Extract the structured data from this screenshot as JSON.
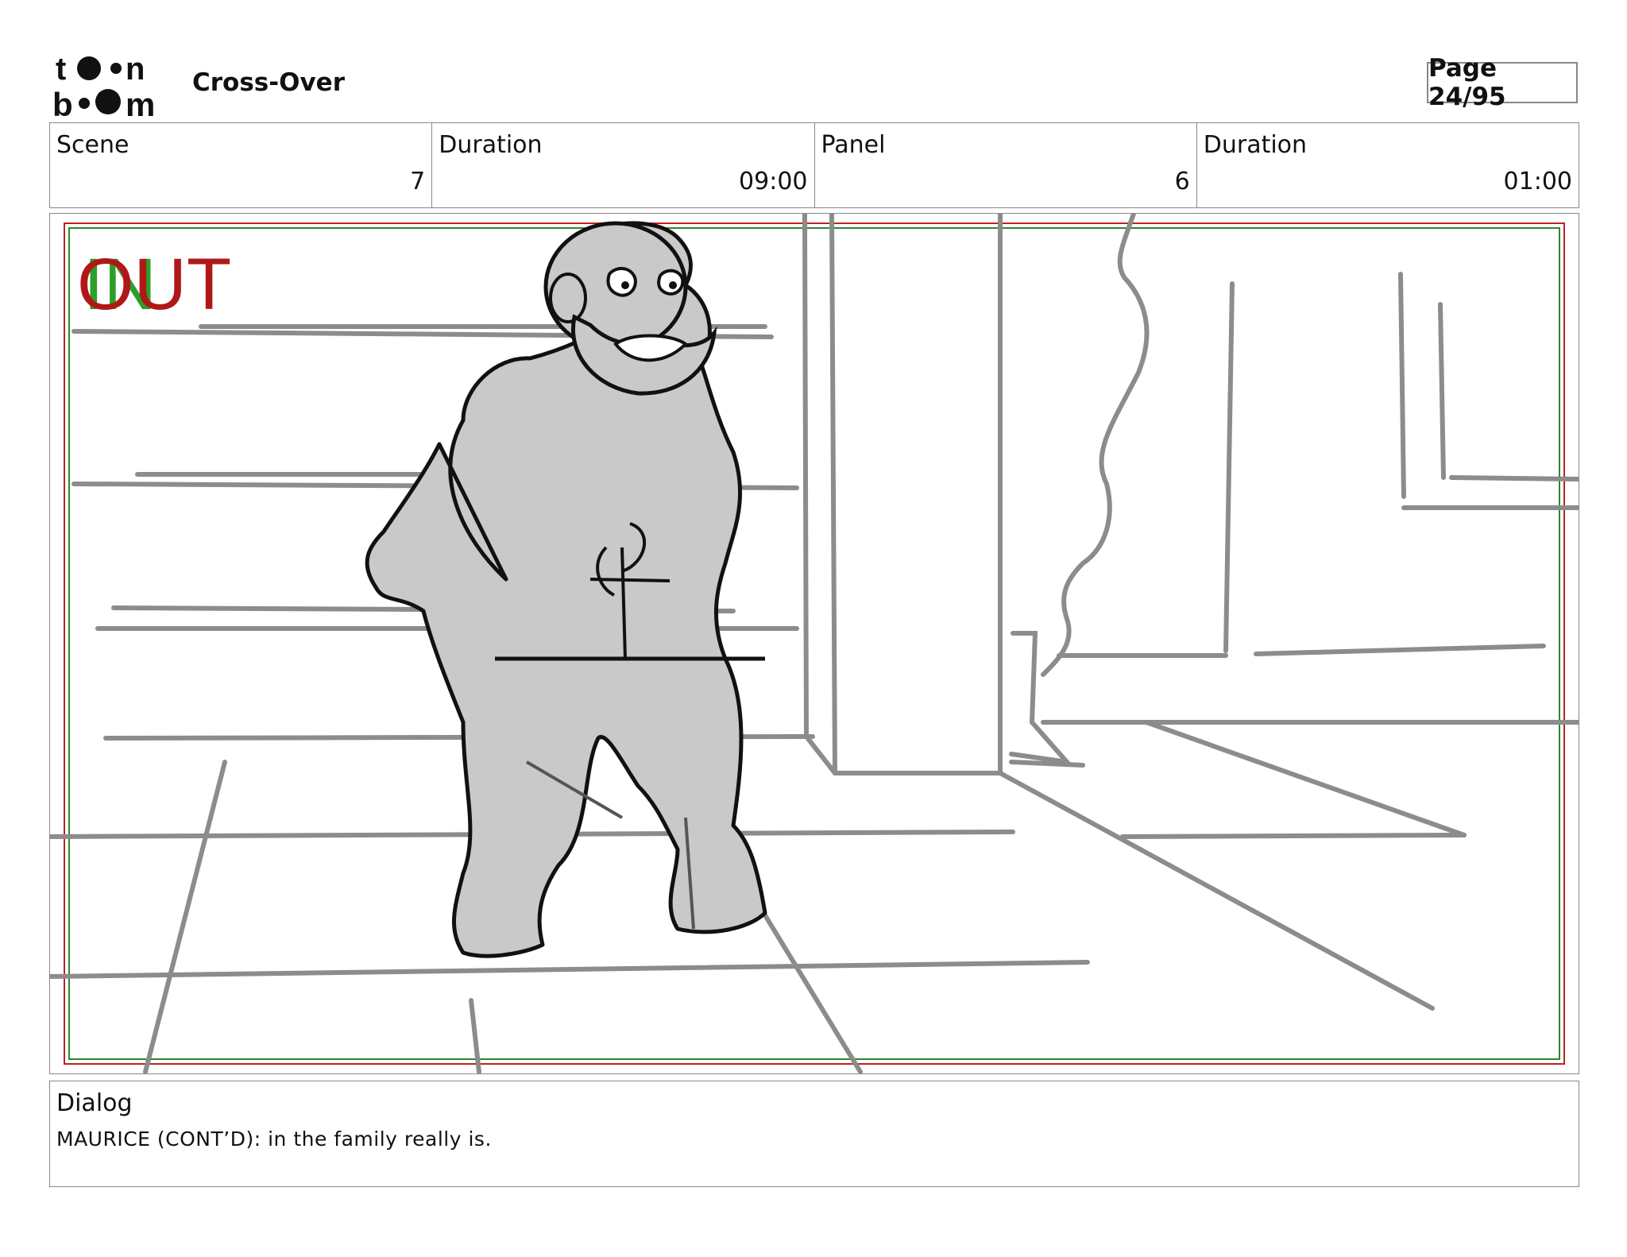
{
  "header": {
    "logo_text": "toonboom",
    "project_title": "Cross-Over",
    "page_label": "Page 24/95"
  },
  "info": {
    "scene_label": "Scene",
    "scene_value": "7",
    "scene_duration_label": "Duration",
    "scene_duration_value": "09:00",
    "panel_label": "Panel",
    "panel_value": "6",
    "panel_duration_label": "Duration",
    "panel_duration_value": "01:00"
  },
  "panel": {
    "in_marker": "IN",
    "out_marker": "OUT",
    "in_color": "#2aa02a",
    "out_color": "#b01818"
  },
  "dialog": {
    "label": "Dialog",
    "text": "MAURICE (CONT’D):  in the family really is."
  }
}
